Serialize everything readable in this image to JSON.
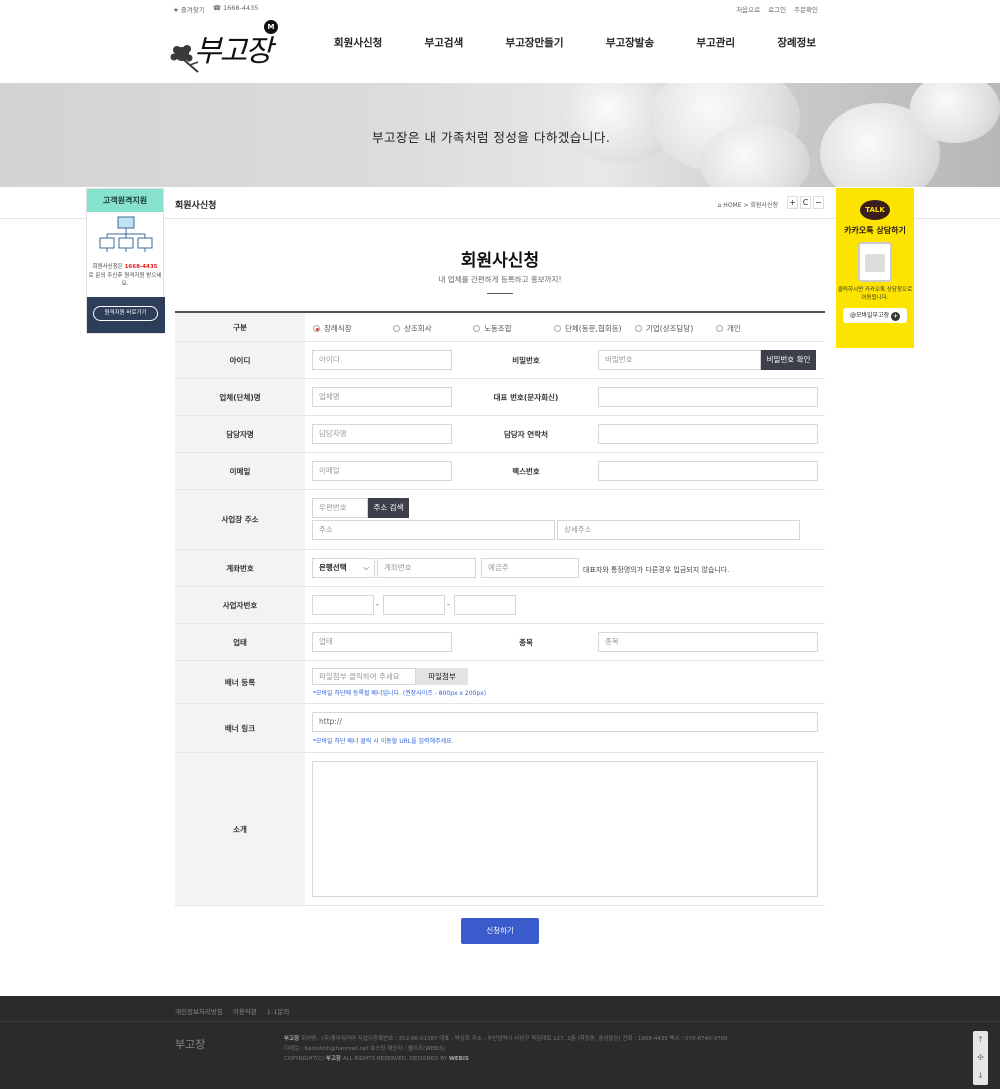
{
  "topbar": {
    "favorite": "★ 즐겨찾기",
    "phone": "☎ 1668-4435",
    "start_page": "처음으로",
    "login": "로그인",
    "order_check": "주문확인"
  },
  "logo": {
    "text": "부고장",
    "badge": "M"
  },
  "nav": [
    "회원사신청",
    "부고검색",
    "부고장만들기",
    "부고장발송",
    "부고관리",
    "장례정보"
  ],
  "banner": {
    "text": "부고장은 내 가족처럼 정성을 다하겠습니다."
  },
  "side_left": {
    "title": "고객원격지원",
    "desc_pre": "회원사신청은",
    "desc_phone": "1668-4435",
    "desc_post": "로 문의 주신후 원격지원 받으세요.",
    "button": "원격지원 바로가기"
  },
  "side_right": {
    "talk": "TALK",
    "title": "카카오톡 상담하기",
    "desc": "클릭하시면 카카오톡 상담창으로 이동됩니다.",
    "pill": "@모바일부고장",
    "pill_icon": "+"
  },
  "pagebar": {
    "title": "회원사신청",
    "crumb_home": "⌂ HOME",
    "crumb_sep": ">",
    "crumb_current": "회원사신청",
    "ctrl_plus": "+",
    "ctrl_refresh": "C",
    "ctrl_minus": "−"
  },
  "heading": {
    "title": "회원사신청",
    "subtitle": "내 업체를 간편하게 등록하고 홍보까지!"
  },
  "form": {
    "type_label": "구분",
    "type_options": [
      "장례식장",
      "상조회사",
      "노동조합",
      "단체(동문,협회등)",
      "기업(상조담당)",
      "개인"
    ],
    "type_selected": 0,
    "id_label": "아이디",
    "id_placeholder": "아이디",
    "pw_label": "비밀번호",
    "pw_placeholder": "비밀번호",
    "pw_button": "비밀번호 확인",
    "company_label": "업체(단체)명",
    "company_placeholder": "업체명",
    "rep_label": "대표 번호(문자회신)",
    "manager_label": "담당자명",
    "manager_placeholder": "담당자명",
    "manager_phone_label": "담당자 연락처",
    "email_label": "이메일",
    "email_placeholder": "이메일",
    "fax_label": "팩스번호",
    "address_label": "사업장 주소",
    "zip_placeholder": "우편번호",
    "zip_button": "주소 검색",
    "addr_placeholder": "주소",
    "addr_detail_placeholder": "상세주소",
    "account_label": "계좌번호",
    "bank_select": "은행선택",
    "bank_chev": "⌵",
    "account_placeholder": "계좌번호",
    "holder_placeholder": "예금주",
    "account_note": "대표자와 통장명의가 다른경우 입금되지 않습니다.",
    "bizno_label": "사업자번호",
    "dash": "-",
    "biztype_label": "업태",
    "biztype_placeholder": "업태",
    "item_label": "종목",
    "item_placeholder": "종목",
    "banner_label": "배너 등록",
    "banner_file_placeholder": "파일첨부 클릭하여 주세요",
    "banner_file_button": "파일첨부",
    "banner_hint": "*모바일 하단에 등록될 배너입니다. (권장사이즈 - 800px x 200px)",
    "link_label": "배너 링크",
    "link_value": "http://",
    "link_hint": "*모바일 하단 배너 클릭 시 이동할 URL을 입력해주세요.",
    "intro_label": "소개"
  },
  "submit": "신청하기",
  "footer": {
    "links": [
      "개인정보처리방침",
      "이용약관",
      "1:1문의"
    ],
    "logo": "부고장",
    "info_line1_brand": "부고장",
    "info_line1": "회사명 : (주)좋아워커마   사업자등록번호 : 352-86-01087   대표 : 박상화   주소 : 부산광역시 사상구 학감대로 127, 2층 (학장동, 중성빌딩)   전화 : 1668-4435   팩스 : 070-8740-9700",
    "info_line2": "이메일 : barkshhh@hanmail.net   호스팅 제공자 : 웰이즈(WEBIS)",
    "info_line3_pre": "COPYRIGHT(C)",
    "info_line3_brand": "부고장",
    "info_line3": "ALL RIGHTS RESERVED. DESIGNED BY",
    "info_line3_designer": "WEBIS"
  },
  "scroller": {
    "up": "↑",
    "mid": "✣",
    "down": "↓"
  }
}
